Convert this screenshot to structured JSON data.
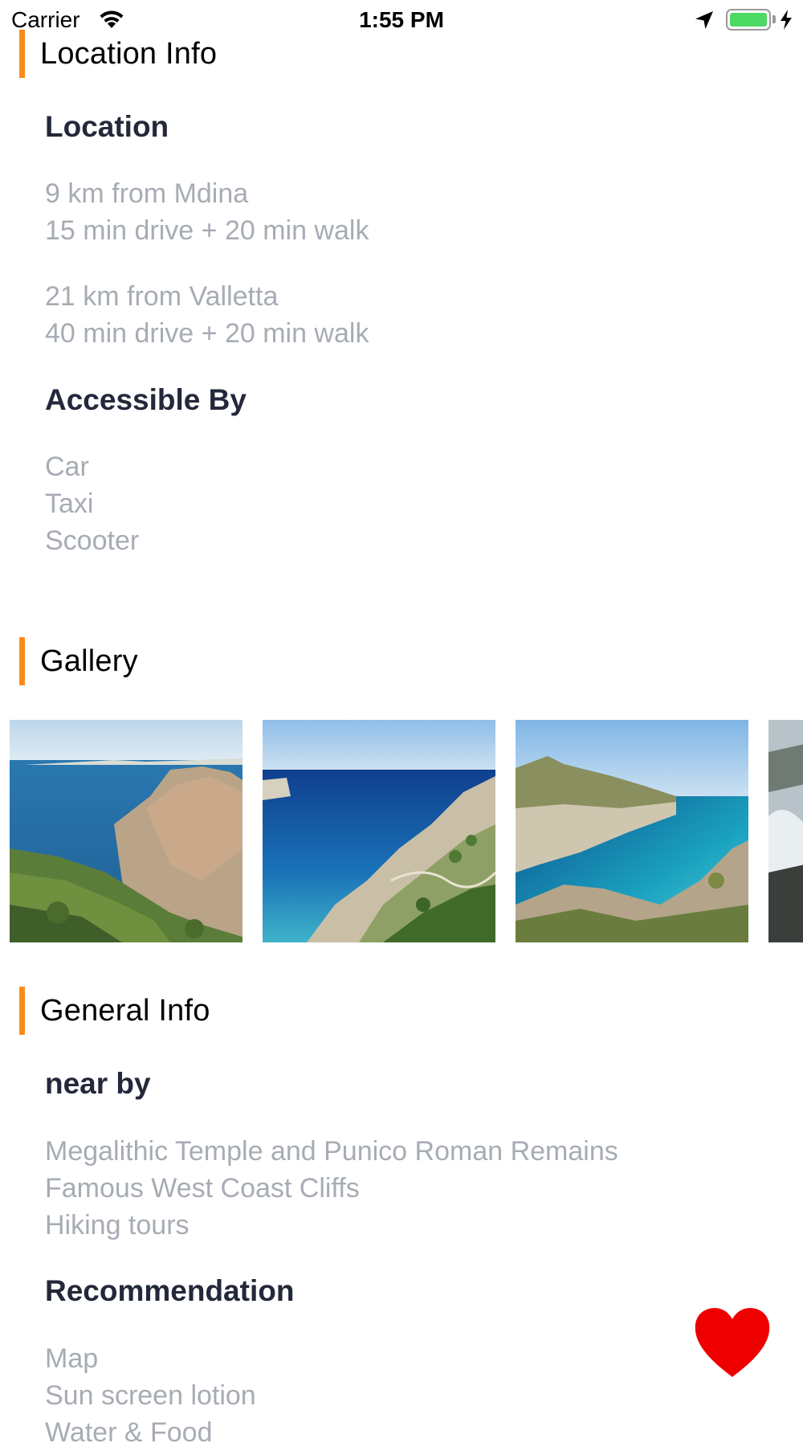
{
  "status_bar": {
    "carrier": "Carrier",
    "time": "1:55 PM",
    "icons": [
      "wifi-icon",
      "location-arrow-icon",
      "battery-icon",
      "charging-bolt-icon"
    ]
  },
  "sections": {
    "location_info": {
      "title": "Location Info",
      "location": {
        "heading": "Location",
        "lines": [
          "9 km from Mdina",
          "15 min drive + 20 min walk",
          "21 km from Valletta",
          "40 min drive + 20 min walk"
        ]
      },
      "accessible_by": {
        "heading": "Accessible By",
        "lines": [
          "Car",
          "Taxi",
          "Scooter"
        ]
      }
    },
    "gallery": {
      "title": "Gallery",
      "photo_count_visible": 4
    },
    "general_info": {
      "title": "General Info",
      "near_by": {
        "heading": "near by",
        "lines": [
          "Megalithic Temple and Punico Roman Remains",
          "Famous West Coast Cliffs",
          "Hiking tours"
        ]
      },
      "recommendation": {
        "heading": "Recommendation",
        "lines": [
          "Map",
          "Sun screen lotion",
          "Water & Food"
        ]
      }
    }
  },
  "colors": {
    "accent": "#ff8a1c",
    "heading": "#23283a",
    "body_text": "#a7acb4",
    "heart": "#ee0000",
    "battery": "#4cd964"
  },
  "favorite": {
    "icon": "heart-icon"
  }
}
